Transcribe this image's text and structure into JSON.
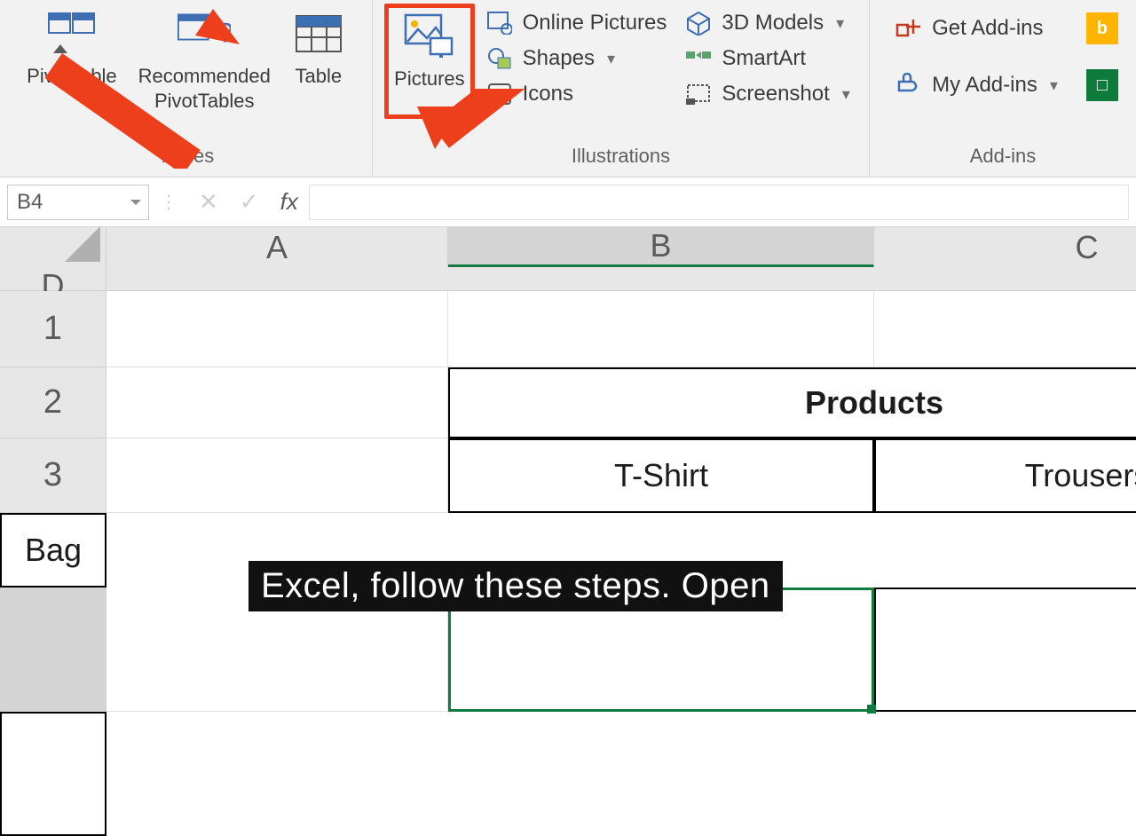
{
  "ribbon": {
    "groups": {
      "tables": {
        "label": "Tables",
        "pivotTable": "PivotTable",
        "recommended": "Recommended\nPivotTables",
        "table": "Table"
      },
      "illustrations": {
        "label": "Illustrations",
        "pictures": "Pictures",
        "onlinePictures": "Online Pictures",
        "shapes": "Shapes",
        "icons": "Icons",
        "models3d": "3D Models",
        "smartart": "SmartArt",
        "screenshot": "Screenshot"
      },
      "addins": {
        "label": "Add-ins",
        "getAddins": "Get Add-ins",
        "myAddins": "My Add-ins"
      }
    }
  },
  "formulaBar": {
    "nameBox": "B4",
    "fx": "fx"
  },
  "grid": {
    "columns": [
      "A",
      "B",
      "C",
      "D"
    ],
    "rows": [
      "1",
      "2",
      "3"
    ],
    "mergedHeader": "Products",
    "products": [
      "T-Shirt",
      "Trousers",
      "Bag"
    ]
  },
  "caption": "Excel, follow these steps. Open",
  "colors": {
    "highlight": "#ed3f1b",
    "excelGreen": "#107c41"
  }
}
